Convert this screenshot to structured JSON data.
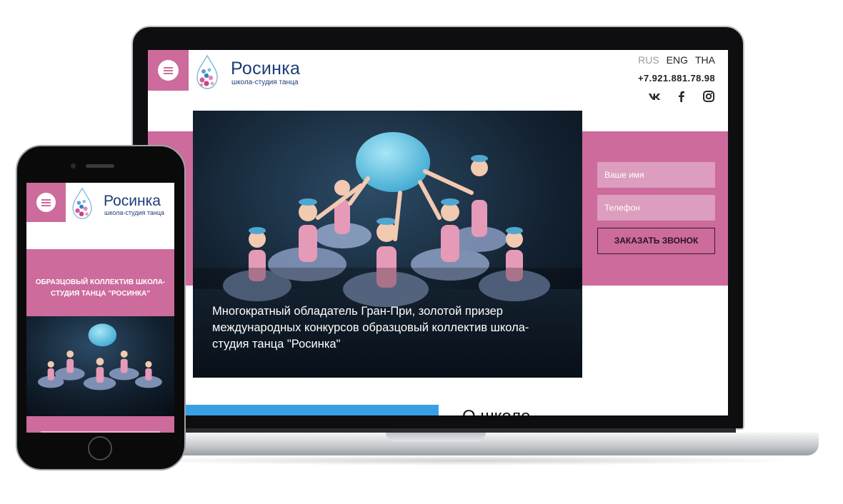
{
  "brand": {
    "name": "Росинка",
    "subtitle": "школа-студия танца"
  },
  "colors": {
    "accent_pink": "#cc6b9c",
    "logo_blue": "#1e3d78",
    "strip_blue": "#3aa0e6"
  },
  "desktop": {
    "languages": [
      "RUS",
      "ENG",
      "THA"
    ],
    "active_language": "RUS",
    "phone": "+7.921.881.78.98",
    "social_icons": [
      "vk-icon",
      "facebook-icon",
      "instagram-icon"
    ],
    "hero_caption": "Многократный обладатель Гран-При, золотой призер международных конкурсов образцовый коллектив школа-студия танца \"Росинка\"",
    "form": {
      "name_placeholder": "Ваше имя",
      "phone_placeholder": "Телефон",
      "submit_label": "ЗАКАЗАТЬ ЗВОНОК"
    },
    "about_heading": "О школе"
  },
  "mobile": {
    "heading": "ОБРАЗЦОВЫЙ КОЛЛЕКТИВ ШКОЛА-СТУДИЯ ТАНЦА \"РОСИНКА\""
  }
}
